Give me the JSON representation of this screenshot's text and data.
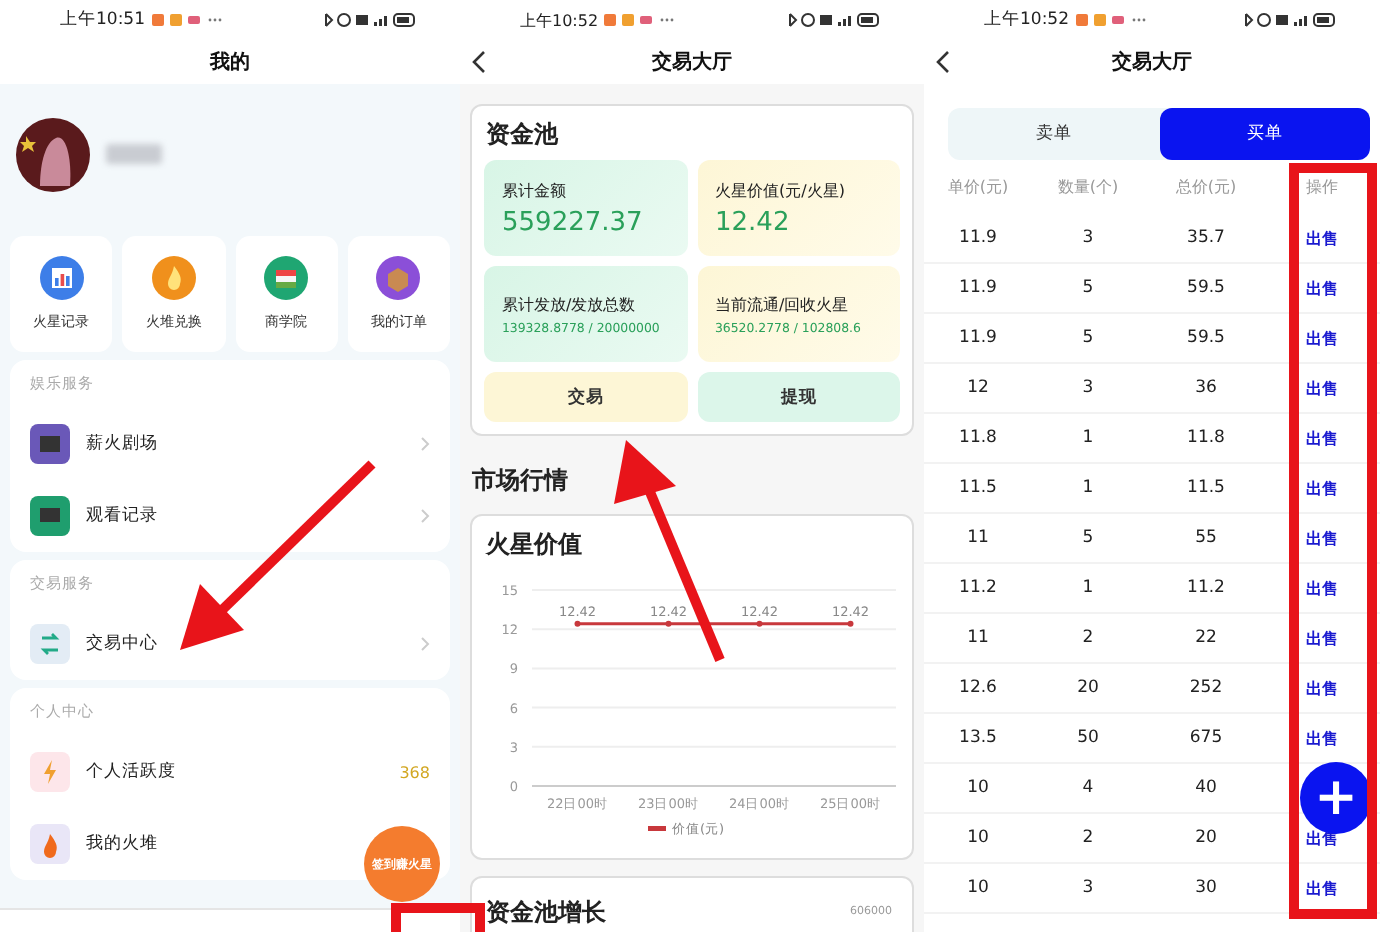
{
  "profile_screen": {
    "status_time": "上午10:51",
    "title": "我的",
    "shortcuts": [
      {
        "label": "火星记录"
      },
      {
        "label": "火堆兑换"
      },
      {
        "label": "商学院"
      },
      {
        "label": "我的订单"
      }
    ],
    "sections": [
      {
        "heading": "娱乐服务",
        "items": [
          {
            "label": "薪火剧场"
          },
          {
            "label": "观看记录"
          }
        ]
      },
      {
        "heading": "交易服务",
        "items": [
          {
            "label": "交易中心"
          }
        ]
      },
      {
        "heading": "个人中心",
        "items": [
          {
            "label": "个人活跃度",
            "value": "368"
          },
          {
            "label": "我的火堆"
          }
        ]
      }
    ],
    "floating_button": "签到赚火星"
  },
  "trade_hall_screen": {
    "status_time": "上午10:52",
    "title": "交易大厅",
    "pool": {
      "title": "资金池",
      "stats": [
        {
          "label": "累计金额",
          "value": "559227.37"
        },
        {
          "label": "火星价值(元/火星)",
          "value": "12.42"
        },
        {
          "label": "累计发放/发放总数",
          "value": "139328.8778 / 20000000"
        },
        {
          "label": "当前流通/回收火星",
          "value": "36520.2778 / 102808.6"
        }
      ],
      "buttons": [
        "交易",
        "提现"
      ]
    },
    "market_heading": "市场行情",
    "price_chart": {
      "title": "火星价值",
      "chart_data": {
        "type": "line",
        "categories": [
          "22日00时",
          "23日00时",
          "24日00时",
          "25日00时"
        ],
        "series": [
          {
            "name": "价值(元)",
            "color": "#c8383c",
            "marker": true,
            "values": [
              12.42,
              12.42,
              12.42,
              12.42
            ]
          }
        ],
        "grid": true,
        "ylim": [
          0,
          15
        ],
        "yticks": [
          0,
          3,
          6,
          9,
          12,
          15
        ],
        "data_labels": true
      }
    },
    "growth_card": {
      "title": "资金池增长",
      "axis_label": "606000"
    }
  },
  "order_screen": {
    "status_time": "上午10:52",
    "title": "交易大厅",
    "tabs": [
      {
        "label": "卖单",
        "selected": false
      },
      {
        "label": "买单",
        "selected": true
      }
    ],
    "columns": [
      "单价(元)",
      "数量(个)",
      "总价(元)",
      "操作"
    ],
    "rows": [
      {
        "cells": [
          "11.9",
          "3",
          "35.7"
        ],
        "action": "出售"
      },
      {
        "cells": [
          "11.9",
          "5",
          "59.5"
        ],
        "action": "出售"
      },
      {
        "cells": [
          "11.9",
          "5",
          "59.5"
        ],
        "action": "出售"
      },
      {
        "cells": [
          "12",
          "3",
          "36"
        ],
        "action": "出售"
      },
      {
        "cells": [
          "11.8",
          "1",
          "11.8"
        ],
        "action": "出售"
      },
      {
        "cells": [
          "11.5",
          "1",
          "11.5"
        ],
        "action": "出售"
      },
      {
        "cells": [
          "11",
          "5",
          "55"
        ],
        "action": "出售"
      },
      {
        "cells": [
          "11.2",
          "1",
          "11.2"
        ],
        "action": "出售"
      },
      {
        "cells": [
          "11",
          "2",
          "22"
        ],
        "action": "出售"
      },
      {
        "cells": [
          "12.6",
          "20",
          "252"
        ],
        "action": "出售"
      },
      {
        "cells": [
          "13.5",
          "50",
          "675"
        ],
        "action": "出售"
      },
      {
        "cells": [
          "10",
          "4",
          "40"
        ]
      },
      {
        "cells": [
          "10",
          "2",
          "20"
        ],
        "action": "出售"
      },
      {
        "cells": [
          "10",
          "3",
          "30"
        ],
        "action": "出售"
      }
    ],
    "add_button": "+"
  }
}
